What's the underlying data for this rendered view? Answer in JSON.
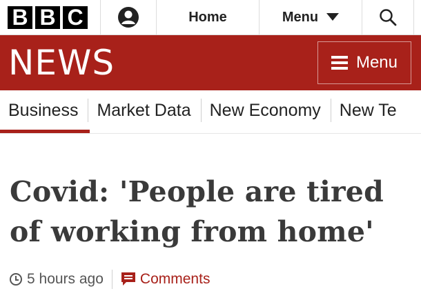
{
  "topbar": {
    "logo_letters": [
      "B",
      "B",
      "C"
    ],
    "account_icon": "account-icon",
    "home_label": "Home",
    "menu_label": "Menu",
    "menu_icon": "triangle-down-icon",
    "search_icon": "search-icon"
  },
  "newsband": {
    "title": "NEWS",
    "menu_label": "Menu",
    "menu_icon": "hamburger-icon"
  },
  "secnav": {
    "items": [
      "Business",
      "Market Data",
      "New Economy",
      "New Te"
    ],
    "active_index": 0
  },
  "article": {
    "headline_line1": "Covid: 'People are tired",
    "headline_line2": "of working from home'",
    "timestamp": "5 hours ago",
    "comments_label": "Comments"
  },
  "colors": {
    "brand_red": "#a8211a",
    "headline": "#3a3a3a"
  }
}
